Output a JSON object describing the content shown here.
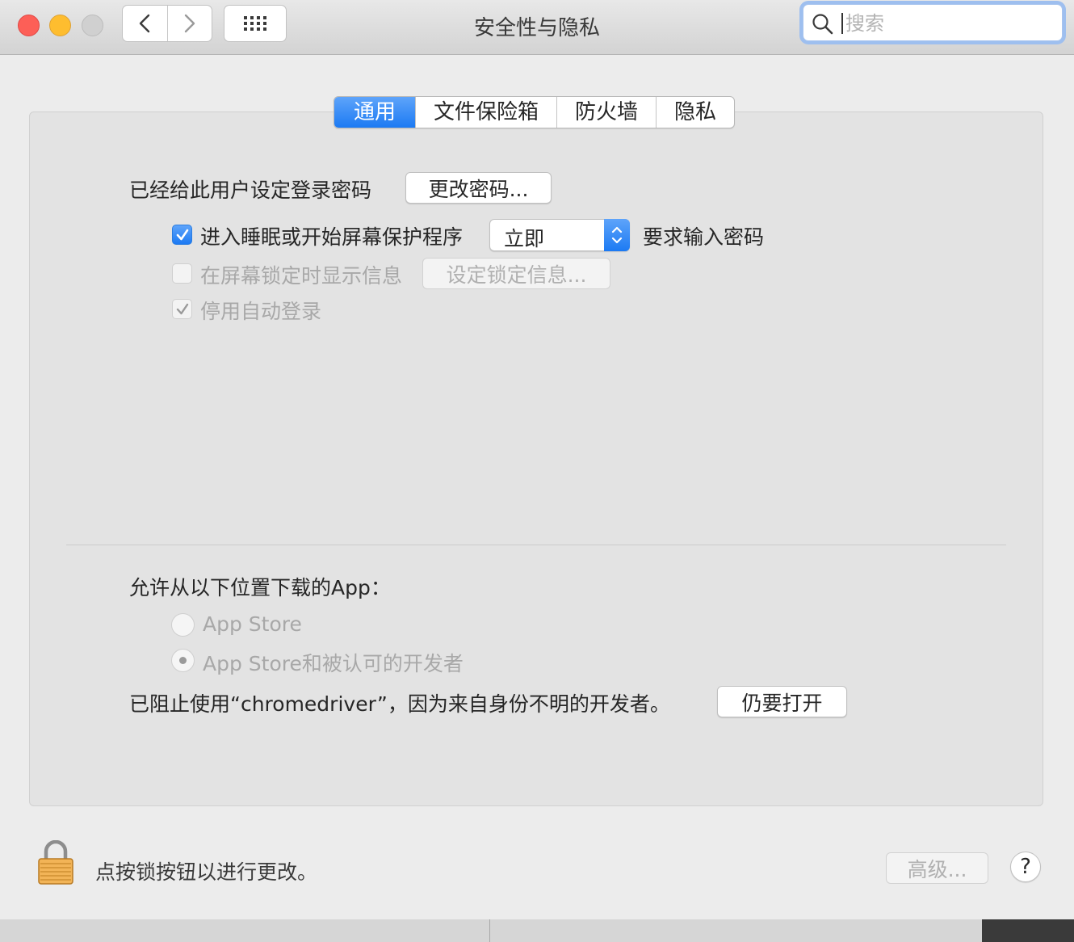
{
  "window": {
    "title": "安全性与隐私"
  },
  "search": {
    "placeholder": "搜索",
    "value": ""
  },
  "tabs": [
    {
      "label": "通用",
      "active": true
    },
    {
      "label": "文件保险箱",
      "active": false
    },
    {
      "label": "防火墙",
      "active": false
    },
    {
      "label": "隐私",
      "active": false
    }
  ],
  "general": {
    "password_label": "已经给此用户设定登录密码",
    "change_password_button": "更改密码...",
    "require_password": {
      "label": "进入睡眠或开始屏幕保护程序",
      "checked": true,
      "delay_value": "立即",
      "suffix": "要求输入密码"
    },
    "lock_message": {
      "label": "在屏幕锁定时显示信息",
      "checked": false,
      "button": "设定锁定信息..."
    },
    "disable_auto_login": {
      "label": "停用自动登录",
      "checked": true
    },
    "allow_apps_label": "允许从以下位置下载的App：",
    "app_sources": [
      {
        "label": "App Store",
        "selected": false
      },
      {
        "label": "App Store和被认可的开发者",
        "selected": true
      }
    ],
    "blocked_message": "已阻止使用“chromedriver”，因为来自身份不明的开发者。",
    "open_anyway_button": "仍要打开"
  },
  "footer": {
    "lock_text": "点按锁按钮以进行更改。",
    "advanced_button": "高级...",
    "help_button": "?"
  },
  "colors": {
    "accent": "#1c7af3",
    "close": "#fd5f57",
    "minimize": "#febd2f"
  }
}
